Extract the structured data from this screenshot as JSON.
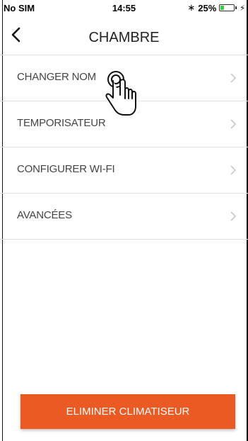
{
  "status_bar": {
    "carrier": "No SIM",
    "time": "14:55",
    "bluetooth_icon": "bluetooth-icon",
    "battery_percent": "25%",
    "battery_level": 0.25,
    "battery_color": "#3ecb3e"
  },
  "nav": {
    "title": "CHAMBRE",
    "back_icon": "chevron-left-icon"
  },
  "menu": {
    "items": [
      {
        "label": "CHANGER NOM"
      },
      {
        "label": "TEMPORISATEUR"
      },
      {
        "label": "CONFIGURER WI-FI"
      },
      {
        "label": "AVANCÉES"
      }
    ]
  },
  "actions": {
    "delete_label": "ELIMINER CLIMATISEUR",
    "delete_color": "#ec5a24"
  }
}
